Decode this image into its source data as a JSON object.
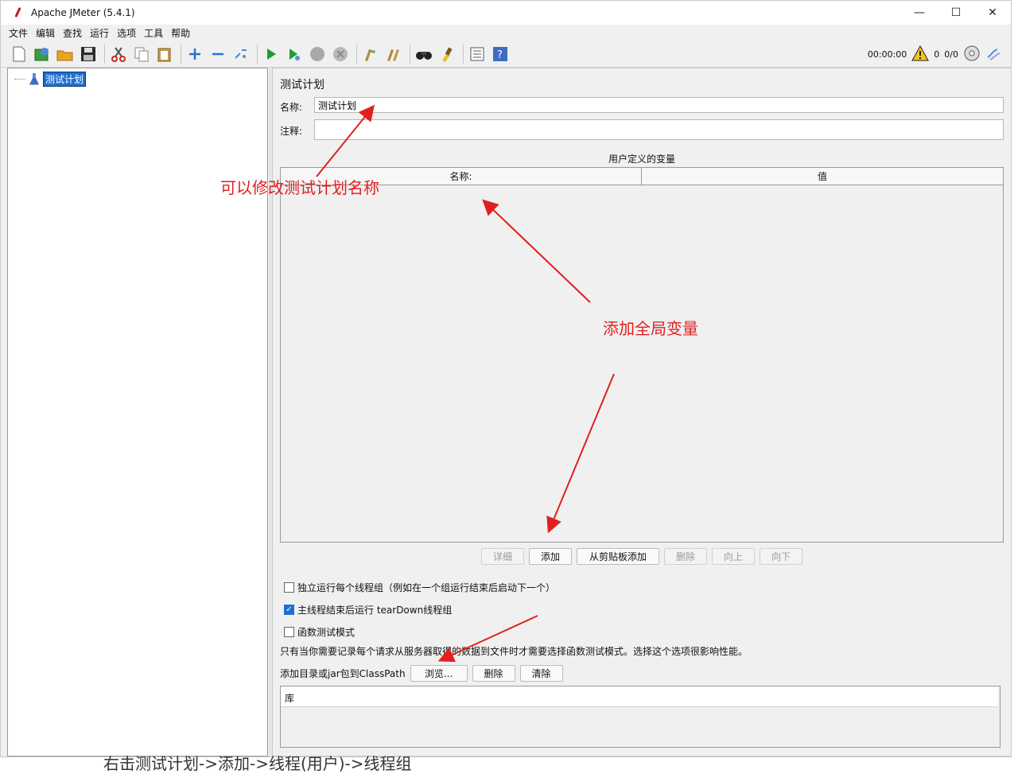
{
  "window": {
    "title": "Apache JMeter (5.4.1)",
    "controls": {
      "minimize": "—",
      "maximize": "☐",
      "close": "✕"
    }
  },
  "menu": [
    "文件",
    "编辑",
    "查找",
    "运行",
    "选项",
    "工具",
    "帮助"
  ],
  "toolbar": {
    "timer": "00:00:00",
    "warnings": "0",
    "threads": "0/0"
  },
  "tree": {
    "root_label": "测试计划"
  },
  "panel": {
    "title": "测试计划",
    "name_label": "名称:",
    "name_value": "测试计划",
    "comment_label": "注释:",
    "comment_value": "",
    "vars_title": "用户定义的变量",
    "col_name": "名称:",
    "col_value": "值",
    "buttons": {
      "detail": "详细",
      "add": "添加",
      "add_clipboard": "从剪贴板添加",
      "delete": "删除",
      "up": "向上",
      "down": "向下"
    },
    "checkbox_independent": "独立运行每个线程组（例如在一个组运行结束后启动下一个）",
    "checkbox_teardown": "主线程结束后运行 tearDown线程组",
    "checkbox_functional": "函数测试模式",
    "functional_note": "只有当你需要记录每个请求从服务器取得的数据到文件时才需要选择函数测试模式。选择这个选项很影响性能。",
    "classpath_label": "添加目录或jar包到ClassPath",
    "browse": "浏览...",
    "cp_delete": "删除",
    "cp_clear": "清除",
    "library_header": "库"
  },
  "annotations": {
    "rename": "可以修改测试计划名称",
    "global_vars": "添加全局变量",
    "bottom_text": "右击测试计划->添加->线程(用户)->线程组"
  },
  "colors": {
    "accent": "#1f6fd1",
    "annotation": "#e02020"
  }
}
